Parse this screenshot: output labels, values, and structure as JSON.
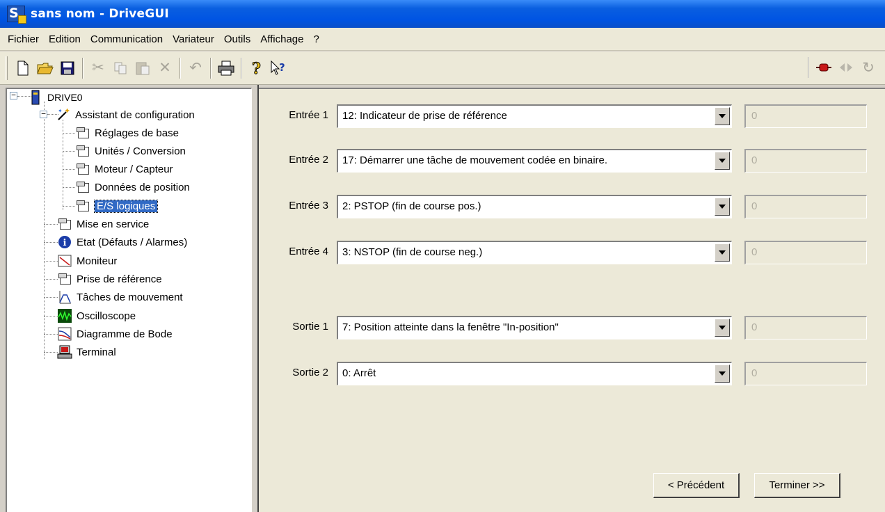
{
  "window": {
    "title": "sans nom - DriveGUI",
    "app_icon_letter": "S"
  },
  "menu": [
    "Fichier",
    "Edition",
    "Communication",
    "Variateur",
    "Outils",
    "Affichage",
    "?"
  ],
  "toolbar": {
    "buttons": [
      "new-icon",
      "open-icon",
      "save-icon",
      "cut-icon",
      "copy-icon",
      "paste-icon",
      "delete-icon",
      "undo-icon",
      "print-icon",
      "help-icon",
      "context-help-icon"
    ],
    "right_buttons": [
      "connect-icon",
      "disconnect-icon",
      "refresh-icon"
    ]
  },
  "tree": {
    "root": "DRIVE0",
    "wizard": "Assistant de configuration",
    "wizard_items": [
      "Réglages de base",
      "Unités / Conversion",
      "Moteur / Capteur",
      "Données de position",
      "E/S logiques"
    ],
    "items": [
      "Mise en service",
      "Etat (Défauts / Alarmes)",
      "Moniteur",
      "Prise de référence",
      "Tâches de mouvement",
      "Oscilloscope",
      "Diagramme de Bode",
      "Terminal"
    ],
    "selected": "E/S logiques"
  },
  "form": {
    "inputs": [
      {
        "label": "Entrée 1",
        "value": "12: Indicateur de prise de référence",
        "param": "0"
      },
      {
        "label": "Entrée 2",
        "value": "17: Démarrer une tâche de mouvement codée en binaire.",
        "param": "0"
      },
      {
        "label": "Entrée 3",
        "value": "2: PSTOP (fin de course pos.)",
        "param": "0"
      },
      {
        "label": "Entrée 4",
        "value": "3: NSTOP (fin de course neg.)",
        "param": "0"
      }
    ],
    "outputs": [
      {
        "label": "Sortie 1",
        "value": "7: Position atteinte dans la fenêtre \"In-position\"",
        "param": "0"
      },
      {
        "label": "Sortie 2",
        "value": "0: Arrêt",
        "param": "0"
      }
    ],
    "prev_label": "< Précédent",
    "finish_label": "Terminer >>"
  }
}
